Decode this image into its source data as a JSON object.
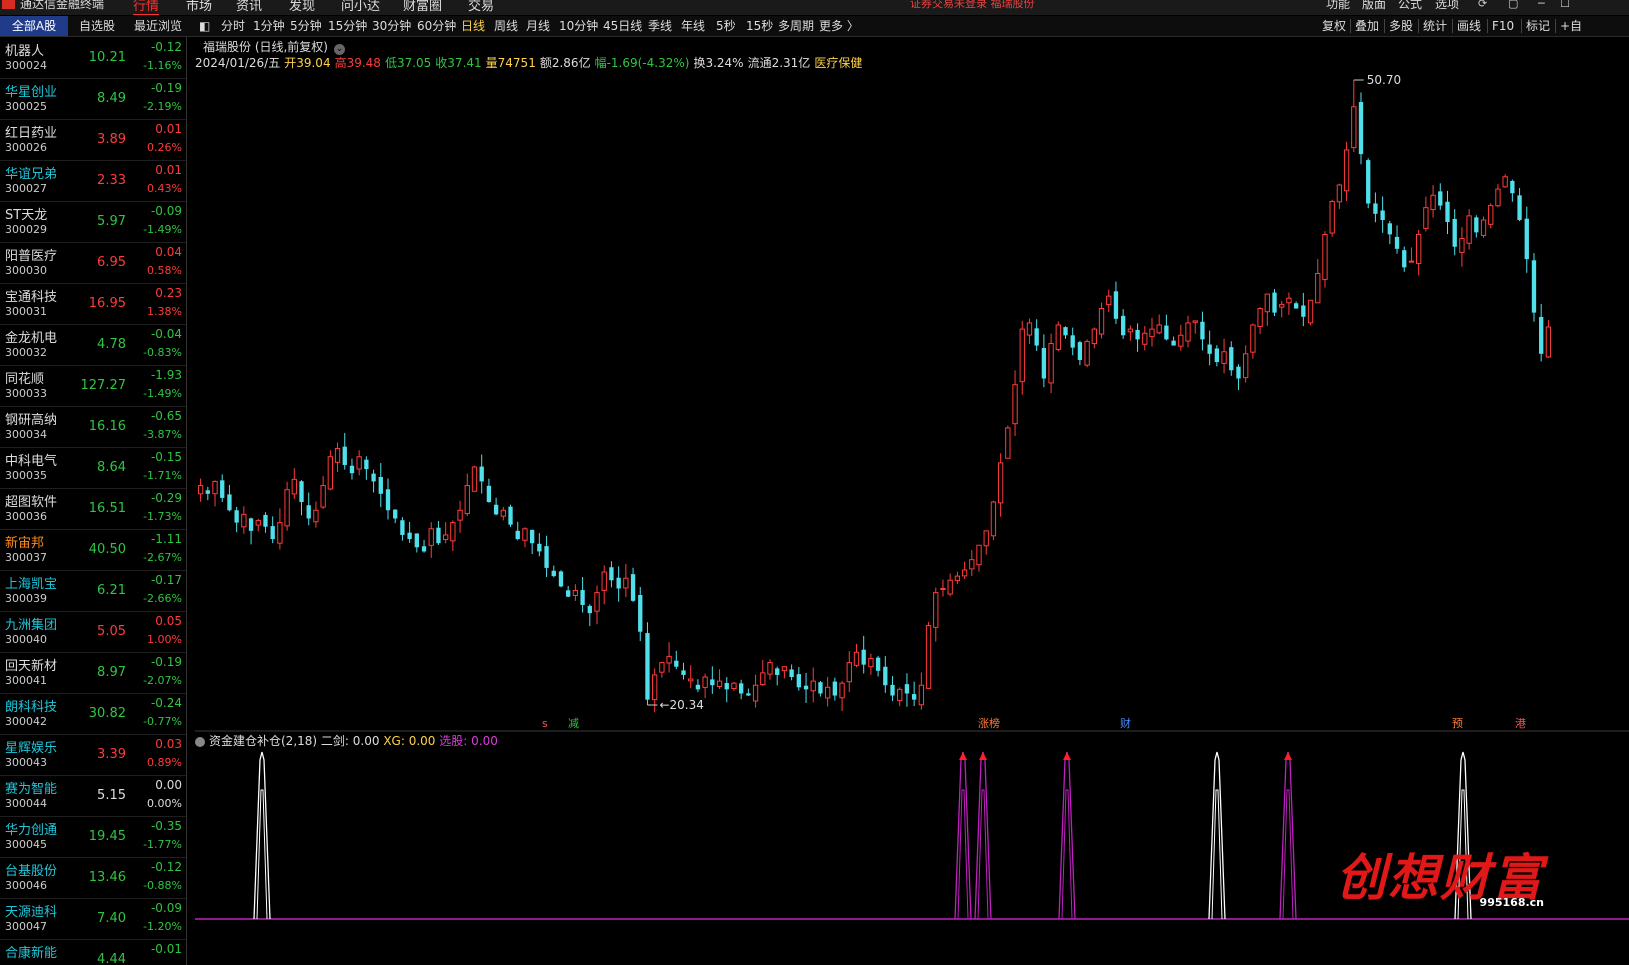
{
  "app": {
    "name": "通达信金融终端",
    "menus": [
      "行情",
      "市场",
      "资讯",
      "发现",
      "问小达",
      "财富圈",
      "交易"
    ],
    "active_menu": "行情",
    "notice": "证券交易未登录  福瑞股份",
    "right_menus": [
      "功能",
      "版面",
      "公式",
      "选项"
    ]
  },
  "list_tabs": [
    "全部A股",
    "自选股",
    "最近浏览"
  ],
  "period_tabs": [
    "分时",
    "1分钟",
    "5分钟",
    "15分钟",
    "30分钟",
    "60分钟",
    "日线",
    "周线",
    "月线",
    "10分钟",
    "45日线",
    "季线",
    "年线",
    "5秒",
    "15秒",
    "多周期",
    "更多 〉"
  ],
  "active_period": "日线",
  "right_tools": [
    "复权",
    "叠加",
    "多股",
    "统计",
    "画线",
    "F10",
    "标记",
    "+自"
  ],
  "stocks": [
    {
      "name": "机器人",
      "code": "300024",
      "price": "10.21",
      "chg": "-0.12",
      "pct": "-1.16%",
      "dir": "dn",
      "nc": ""
    },
    {
      "name": "华星创业",
      "code": "300025",
      "price": "8.49",
      "chg": "-0.19",
      "pct": "-2.19%",
      "dir": "dn",
      "nc": "teal"
    },
    {
      "name": "红日药业",
      "code": "300026",
      "price": "3.89",
      "chg": "0.01",
      "pct": "0.26%",
      "dir": "up",
      "nc": ""
    },
    {
      "name": "华谊兄弟",
      "code": "300027",
      "price": "2.33",
      "chg": "0.01",
      "pct": "0.43%",
      "dir": "up",
      "nc": "teal"
    },
    {
      "name": "ST天龙",
      "code": "300029",
      "price": "5.97",
      "chg": "-0.09",
      "pct": "-1.49%",
      "dir": "dn",
      "nc": ""
    },
    {
      "name": "阳普医疗",
      "code": "300030",
      "price": "6.95",
      "chg": "0.04",
      "pct": "0.58%",
      "dir": "up",
      "nc": ""
    },
    {
      "name": "宝通科技",
      "code": "300031",
      "price": "16.95",
      "chg": "0.23",
      "pct": "1.38%",
      "dir": "up",
      "nc": ""
    },
    {
      "name": "金龙机电",
      "code": "300032",
      "price": "4.78",
      "chg": "-0.04",
      "pct": "-0.83%",
      "dir": "dn",
      "nc": ""
    },
    {
      "name": "同花顺",
      "code": "300033",
      "price": "127.27",
      "chg": "-1.93",
      "pct": "-1.49%",
      "dir": "dn",
      "nc": ""
    },
    {
      "name": "钢研高纳",
      "code": "300034",
      "price": "16.16",
      "chg": "-0.65",
      "pct": "-3.87%",
      "dir": "dn",
      "nc": ""
    },
    {
      "name": "中科电气",
      "code": "300035",
      "price": "8.64",
      "chg": "-0.15",
      "pct": "-1.71%",
      "dir": "dn",
      "nc": ""
    },
    {
      "name": "超图软件",
      "code": "300036",
      "price": "16.51",
      "chg": "-0.29",
      "pct": "-1.73%",
      "dir": "dn",
      "nc": ""
    },
    {
      "name": "新宙邦",
      "code": "300037",
      "price": "40.50",
      "chg": "-1.11",
      "pct": "-2.67%",
      "dir": "dn",
      "nc": "orange"
    },
    {
      "name": "上海凯宝",
      "code": "300039",
      "price": "6.21",
      "chg": "-0.17",
      "pct": "-2.66%",
      "dir": "dn",
      "nc": "teal"
    },
    {
      "name": "九洲集团",
      "code": "300040",
      "price": "5.05",
      "chg": "0.05",
      "pct": "1.00%",
      "dir": "up",
      "nc": "teal"
    },
    {
      "name": "回天新材",
      "code": "300041",
      "price": "8.97",
      "chg": "-0.19",
      "pct": "-2.07%",
      "dir": "dn",
      "nc": ""
    },
    {
      "name": "朗科科技",
      "code": "300042",
      "price": "30.82",
      "chg": "-0.24",
      "pct": "-0.77%",
      "dir": "dn",
      "nc": "teal"
    },
    {
      "name": "星辉娱乐",
      "code": "300043",
      "price": "3.39",
      "chg": "0.03",
      "pct": "0.89%",
      "dir": "up",
      "nc": "teal"
    },
    {
      "name": "赛为智能",
      "code": "300044",
      "price": "5.15",
      "chg": "0.00",
      "pct": "0.00%",
      "dir": "fl",
      "nc": "teal"
    },
    {
      "name": "华力创通",
      "code": "300045",
      "price": "19.45",
      "chg": "-0.35",
      "pct": "-1.77%",
      "dir": "dn",
      "nc": "teal"
    },
    {
      "name": "台基股份",
      "code": "300046",
      "price": "13.46",
      "chg": "-0.12",
      "pct": "-0.88%",
      "dir": "dn",
      "nc": "teal"
    },
    {
      "name": "天源迪科",
      "code": "300047",
      "price": "7.40",
      "chg": "-0.09",
      "pct": "-1.20%",
      "dir": "dn",
      "nc": "teal"
    },
    {
      "name": "合康新能",
      "code": "",
      "price": "4.44",
      "chg": "-0.01",
      "pct": "",
      "dir": "dn",
      "nc": "teal"
    }
  ],
  "chart": {
    "title": "福瑞股份 (日线,前复权)",
    "date": "2024/01/26/五",
    "open": "开39.04",
    "high": "高39.48",
    "low": "低37.05",
    "close": "收37.41",
    "vol": "量74751",
    "amt": "额2.86亿",
    "amp": "幅-1.69(-4.32%)",
    "turn": "换3.24%",
    "float": "流通2.31亿",
    "sector": "医疗保健",
    "max_label": "50.70",
    "min_label": "20.34",
    "markers": [
      "s",
      "减",
      "涨榜",
      "财",
      "预",
      "港"
    ],
    "indicator": {
      "name": "资金建仓补仓(2,18)",
      "erjian": "二剑: 0.00",
      "xg": "XG: 0.00",
      "xuangu": "选股: 0.00"
    }
  },
  "watermark": {
    "text": "创想财富",
    "site": "995168.cn"
  },
  "chart_data": {
    "type": "candlestick",
    "closes": [
      31.0,
      30.6,
      31.2,
      30.4,
      29.8,
      29.2,
      29.6,
      28.8,
      29.3,
      29.0,
      28.4,
      29.2,
      30.8,
      31.3,
      30.2,
      29.4,
      29.8,
      31.0,
      32.4,
      32.8,
      32.0,
      31.6,
      32.4,
      31.8,
      31.2,
      30.6,
      29.8,
      29.4,
      28.6,
      28.4,
      28.0,
      27.8,
      28.9,
      28.2,
      28.6,
      29.2,
      29.8,
      31.0,
      31.9,
      31.2,
      30.2,
      29.6,
      29.8,
      29.1,
      28.4,
      28.9,
      28.2,
      27.8,
      27.0,
      26.6,
      26.1,
      25.6,
      25.9,
      25.2,
      24.8,
      25.8,
      26.8,
      26.4,
      26.0,
      26.5,
      25.4,
      23.9,
      20.6,
      21.8,
      22.4,
      22.7,
      22.2,
      21.8,
      21.6,
      21.1,
      21.7,
      21.3,
      21.5,
      21.1,
      21.4,
      20.9,
      20.8,
      21.3,
      21.9,
      22.4,
      21.8,
      22.2,
      21.7,
      21.2,
      21.1,
      21.5,
      20.9,
      21.2,
      20.8,
      21.4,
      22.4,
      22.9,
      22.3,
      22.6,
      22.0,
      21.3,
      20.8,
      21.1,
      20.9,
      20.6,
      21.3,
      24.2,
      25.8,
      26.0,
      26.4,
      26.6,
      26.9,
      27.4,
      28.1,
      28.8,
      30.2,
      32.1,
      33.8,
      35.9,
      38.6,
      38.9,
      37.8,
      36.2,
      37.9,
      38.8,
      38.3,
      37.7,
      37.1,
      38.0,
      38.6,
      39.6,
      40.2,
      39.1,
      38.3,
      38.6,
      38.1,
      38.4,
      38.6,
      38.8,
      38.1,
      37.8,
      38.3,
      38.9,
      39.0,
      38.1,
      37.4,
      37.0,
      37.5,
      36.6,
      36.2,
      37.4,
      38.8,
      39.6,
      40.3,
      39.4,
      39.8,
      40.1,
      39.6,
      39.2,
      40.0,
      41.3,
      43.2,
      44.8,
      45.6,
      47.3,
      49.4,
      47.1,
      44.7,
      44.2,
      43.9,
      43.2,
      42.5,
      41.6,
      41.9,
      43.2,
      44.5,
      45.1,
      44.6,
      43.8,
      42.6,
      43.0,
      44.1,
      43.3,
      43.9,
      44.6,
      45.4,
      46.0,
      45.2,
      43.9,
      42.0,
      39.4,
      37.4,
      38.7
    ]
  }
}
